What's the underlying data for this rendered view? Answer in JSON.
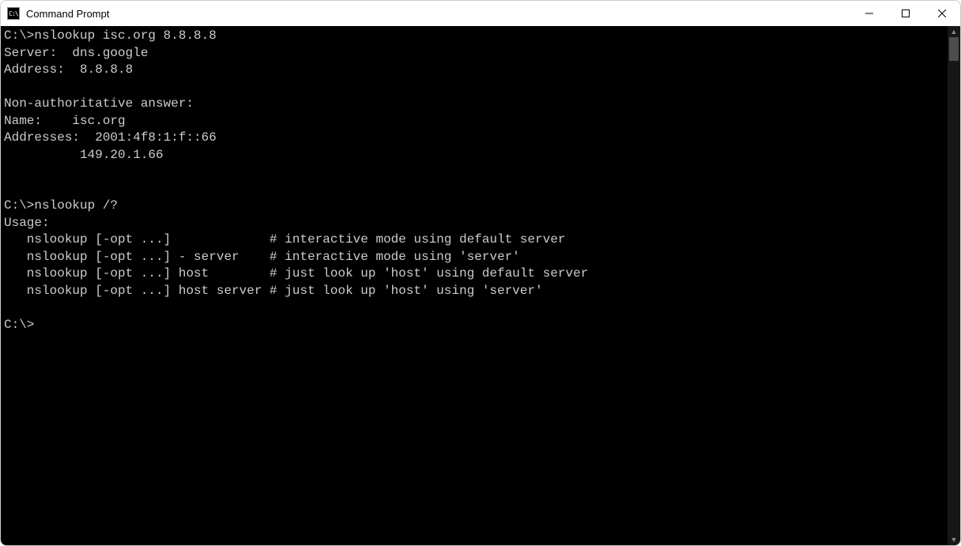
{
  "window": {
    "title": "Command Prompt"
  },
  "terminal": {
    "lines": [
      "C:\\>nslookup isc.org 8.8.8.8",
      "Server:  dns.google",
      "Address:  8.8.8.8",
      "",
      "Non-authoritative answer:",
      "Name:    isc.org",
      "Addresses:  2001:4f8:1:f::66",
      "          149.20.1.66",
      "",
      "",
      "C:\\>nslookup /?",
      "Usage:",
      "   nslookup [-opt ...]             # interactive mode using default server",
      "   nslookup [-opt ...] - server    # interactive mode using 'server'",
      "   nslookup [-opt ...] host        # just look up 'host' using default server",
      "   nslookup [-opt ...] host server # just look up 'host' using 'server'",
      "",
      "C:\\>"
    ]
  }
}
